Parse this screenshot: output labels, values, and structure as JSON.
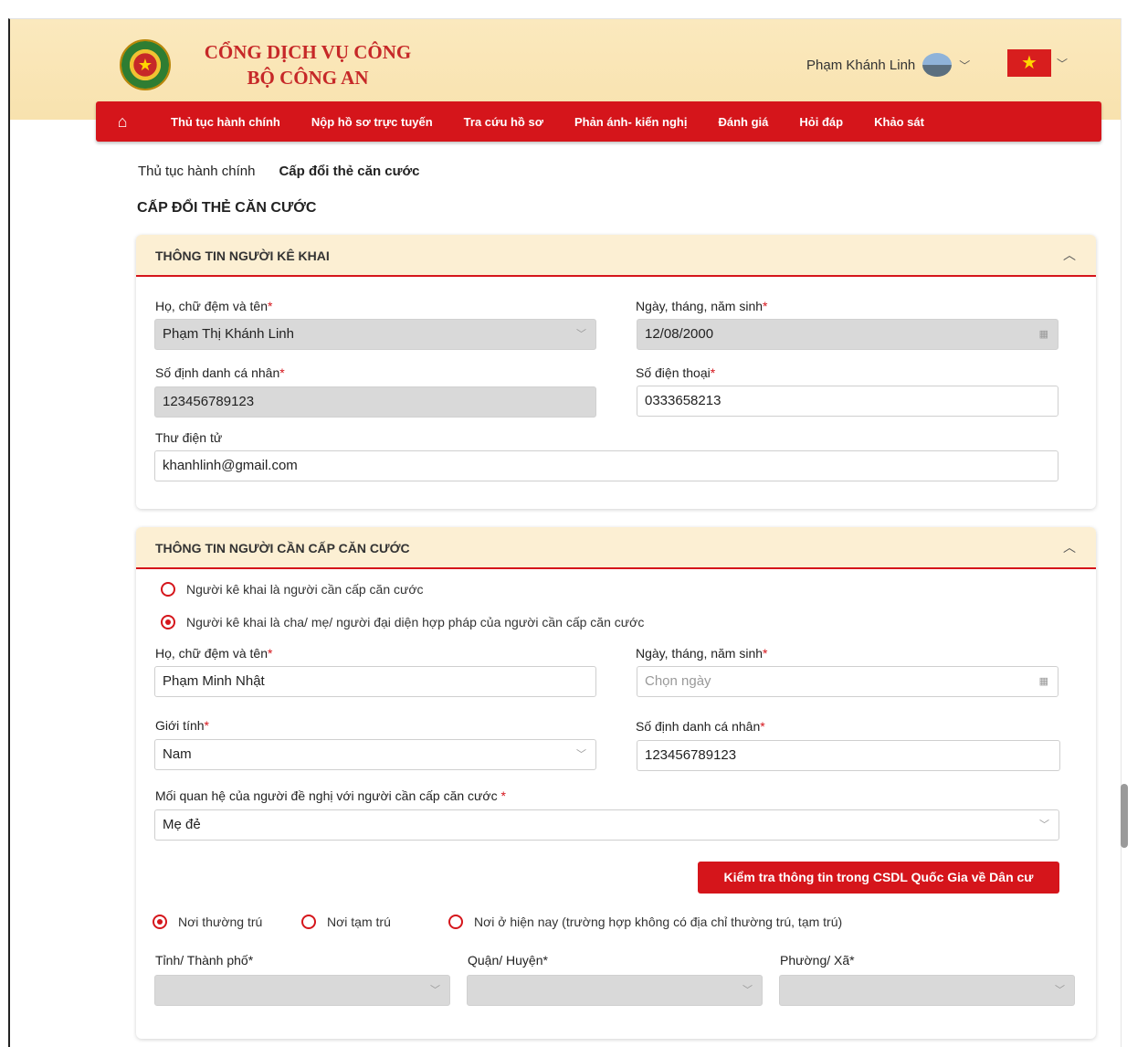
{
  "header": {
    "brand_line1": "CỔNG DỊCH VỤ CÔNG",
    "brand_line2": "BỘ CÔNG AN",
    "user_name": "Phạm Khánh Linh"
  },
  "nav": {
    "items": [
      "Thủ tục hành chính",
      "Nộp hồ sơ trực tuyến",
      "Tra cứu hồ sơ",
      "Phản ánh- kiến nghị",
      "Đánh giá",
      "Hỏi đáp",
      "Khảo sát"
    ]
  },
  "breadcrumb": {
    "parent": "Thủ tục hành chính",
    "current": "Cấp đổi thẻ căn cước"
  },
  "page_title": "CẤP ĐỔI THẺ CĂN CƯỚC",
  "declarant": {
    "section_title": "THÔNG TIN NGƯỜI KÊ KHAI",
    "full_name_label": "Họ, chữ đệm và tên",
    "full_name": "Phạm Thị Khánh Linh",
    "dob_label": "Ngày, tháng, năm sinh",
    "dob": "12/08/2000",
    "id_label": "Số định danh cá nhân",
    "id_number": "123456789123",
    "phone_label": "Số điện thoại",
    "phone": "0333658213",
    "email_label": "Thư điện tử",
    "email": "khanhlinh@gmail.com"
  },
  "applicant": {
    "section_title": "THÔNG TIN NGƯỜI CẦN CẤP CĂN CƯỚC",
    "option_self": "Người kê khai là người cần cấp căn cước",
    "option_guardian": "Người kê khai là cha/ mẹ/ người đại diện hợp pháp của người cần cấp căn cước",
    "selected_option": "guardian",
    "full_name_label": "Họ, chữ đệm và tên",
    "full_name": "Phạm Minh Nhật",
    "dob_label": "Ngày, tháng, năm sinh",
    "dob_placeholder": "Chọn ngày",
    "gender_label": "Giới tính",
    "gender": "Nam",
    "id_label": "Số định danh cá nhân",
    "id_number": "123456789123",
    "relation_label": "Mối quan hệ của người đề nghị với người cần cấp căn cước",
    "relation": "Mẹ đẻ",
    "check_button": "Kiểm tra thông tin trong CSDL Quốc Gia về Dân cư",
    "residence_permanent": "Nơi thường trú",
    "residence_temporary": "Nơi tạm trú",
    "residence_current": "Nơi ở hiện nay (trường hợp không có địa chỉ thường trú, tạm trú)",
    "selected_residence": "permanent",
    "province_label": "Tỉnh/ Thành phố*",
    "district_label": "Quận/ Huyện*",
    "ward_label": "Phường/ Xã*"
  },
  "colors": {
    "primary_red": "#d5151b",
    "header_bg": "#fbe9be",
    "section_head_bg": "#fcefd3"
  }
}
